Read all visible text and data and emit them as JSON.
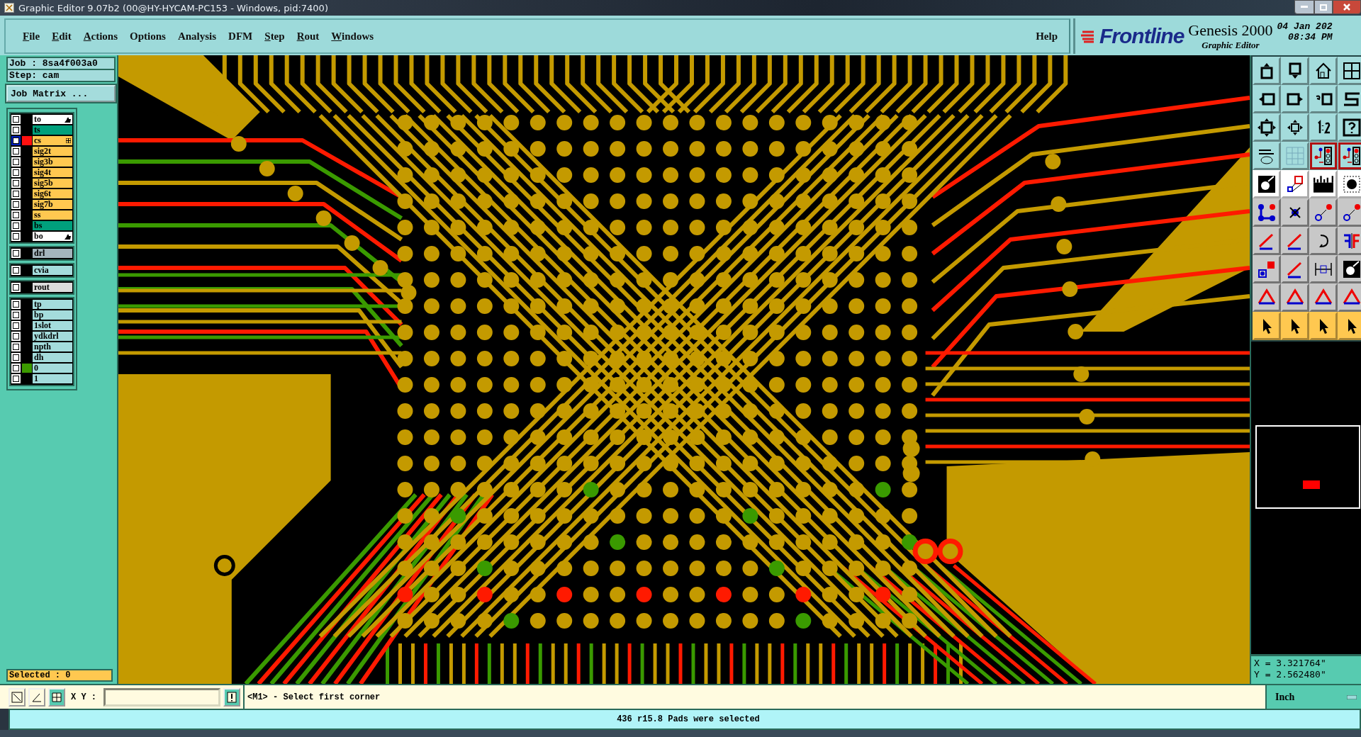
{
  "window": {
    "title": "Graphic Editor 9.07b2 (00@HY-HYCAM-PC153 - Windows, pid:7400)"
  },
  "menu": [
    {
      "label": "File",
      "underlined": true
    },
    {
      "label": "Edit",
      "underlined": true
    },
    {
      "label": "Actions",
      "underlined": true
    },
    {
      "label": "Options",
      "underlined": false
    },
    {
      "label": "Analysis",
      "underlined": false
    },
    {
      "label": "DFM",
      "underlined": false
    },
    {
      "label": "Step",
      "underlined": true
    },
    {
      "label": "Rout",
      "underlined": true
    },
    {
      "label": "Windows",
      "underlined": true
    }
  ],
  "help": "Help",
  "brand": {
    "logo": "Frontline",
    "product": "Genesis 2000",
    "subtitle": "Graphic Editor",
    "date": "04 Jan 202",
    "time": "08:34 PM"
  },
  "job": {
    "job": "Job : 8sa4f003a0",
    "step": "Step: cam",
    "matrix_button": "Job Matrix ..."
  },
  "layer_groups": [
    [
      {
        "name": "to",
        "kind": "silk",
        "checked": false,
        "work": false,
        "pinned": true
      },
      {
        "name": "ts",
        "kind": "mask",
        "checked": false,
        "work": false,
        "pinned": false
      },
      {
        "name": "cs",
        "kind": "signal",
        "checked": false,
        "work": true,
        "pinned": false,
        "color": "#ff1010"
      },
      {
        "name": "sig2t",
        "kind": "signal",
        "checked": false,
        "work": false,
        "pinned": false
      },
      {
        "name": "sig3b",
        "kind": "signal",
        "checked": false,
        "work": false,
        "pinned": false
      },
      {
        "name": "sig4t",
        "kind": "signal",
        "checked": false,
        "work": false,
        "pinned": false
      },
      {
        "name": "sig5b",
        "kind": "signal",
        "checked": false,
        "work": false,
        "pinned": false
      },
      {
        "name": "sig6t",
        "kind": "signal",
        "checked": false,
        "work": false,
        "pinned": false
      },
      {
        "name": "sig7b",
        "kind": "signal",
        "checked": false,
        "work": false,
        "pinned": false
      },
      {
        "name": "ss",
        "kind": "signal",
        "checked": false,
        "work": false,
        "pinned": false
      },
      {
        "name": "bs",
        "kind": "mask",
        "checked": false,
        "work": false,
        "pinned": false
      },
      {
        "name": "bo",
        "kind": "silk",
        "checked": false,
        "work": false,
        "pinned": true
      }
    ],
    [
      {
        "name": "drl",
        "kind": "drill",
        "checked": false,
        "work": false,
        "pinned": false
      }
    ],
    [
      {
        "name": "cvia",
        "kind": "misc",
        "checked": false,
        "work": false,
        "pinned": false
      }
    ],
    [
      {
        "name": "rout",
        "kind": "rout",
        "checked": false,
        "work": false,
        "pinned": false
      }
    ],
    [
      {
        "name": "tp",
        "kind": "misc",
        "checked": false,
        "work": false,
        "pinned": false
      },
      {
        "name": "bp",
        "kind": "misc",
        "checked": false,
        "work": false,
        "pinned": false
      },
      {
        "name": "1slot",
        "kind": "misc",
        "checked": false,
        "work": false,
        "pinned": false
      },
      {
        "name": "ydkdrl",
        "kind": "misc",
        "checked": false,
        "work": false,
        "pinned": false
      },
      {
        "name": "npth",
        "kind": "misc",
        "checked": false,
        "work": false,
        "pinned": false
      },
      {
        "name": "dh",
        "kind": "misc",
        "checked": false,
        "work": false,
        "pinned": false
      },
      {
        "name": "0",
        "kind": "misc",
        "checked": false,
        "work": false,
        "pinned": false,
        "color": "#3c9a00"
      },
      {
        "name": "1",
        "kind": "misc",
        "checked": false,
        "work": false,
        "pinned": false
      }
    ]
  ],
  "selected_count": "Selected : 0",
  "tool_buttons": [
    {
      "kind": "view",
      "selected": false
    },
    {
      "kind": "view",
      "selected": false
    },
    {
      "kind": "view",
      "selected": false
    },
    {
      "kind": "view",
      "selected": false
    },
    {
      "kind": "view",
      "selected": false
    },
    {
      "kind": "view",
      "selected": false
    },
    {
      "kind": "view",
      "selected": false
    },
    {
      "kind": "view",
      "selected": false
    },
    {
      "kind": "view",
      "selected": false
    },
    {
      "kind": "view",
      "selected": false
    },
    {
      "kind": "view",
      "selected": false
    },
    {
      "kind": "view",
      "selected": false
    },
    {
      "kind": "view",
      "selected": false
    },
    {
      "kind": "view",
      "selected": false
    },
    {
      "kind": "view",
      "selected": true
    },
    {
      "kind": "view",
      "selected": true
    },
    {
      "kind": "mode",
      "selected": false
    },
    {
      "kind": "mode",
      "selected": false
    },
    {
      "kind": "mode",
      "selected": false
    },
    {
      "kind": "mode",
      "selected": false
    },
    {
      "kind": "edit",
      "selected": false
    },
    {
      "kind": "edit",
      "selected": false
    },
    {
      "kind": "edit",
      "selected": false
    },
    {
      "kind": "edit",
      "selected": false
    },
    {
      "kind": "edit",
      "selected": false
    },
    {
      "kind": "edit",
      "selected": false
    },
    {
      "kind": "edit",
      "selected": false
    },
    {
      "kind": "edit",
      "selected": false
    },
    {
      "kind": "edit",
      "selected": false
    },
    {
      "kind": "edit",
      "selected": false
    },
    {
      "kind": "edit",
      "selected": false
    },
    {
      "kind": "edit",
      "selected": false
    },
    {
      "kind": "edit",
      "selected": false
    },
    {
      "kind": "edit",
      "selected": false
    },
    {
      "kind": "edit",
      "selected": false
    },
    {
      "kind": "edit",
      "selected": false
    },
    {
      "kind": "select",
      "selected": false
    },
    {
      "kind": "select",
      "selected": false
    },
    {
      "kind": "select",
      "selected": false
    },
    {
      "kind": "select",
      "selected": false
    }
  ],
  "coordinates": {
    "x": "X = 3.321764\"",
    "y": "Y = 2.562480\""
  },
  "command_bar": {
    "xy_label": "X Y :",
    "prompt": "<M1> - Select first corner",
    "units": "Inch"
  },
  "status": "436 r15.8 Pads were selected"
}
